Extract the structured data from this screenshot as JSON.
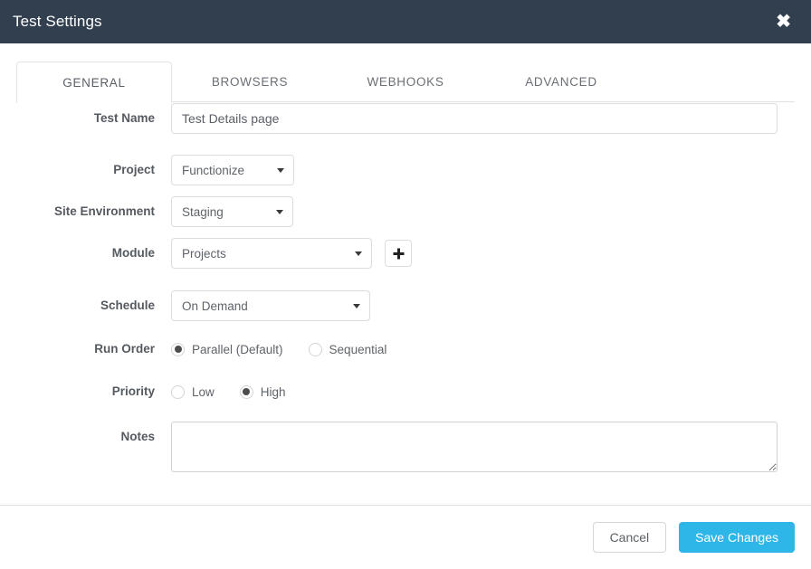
{
  "header": {
    "title": "Test Settings",
    "close_label": "✖"
  },
  "tabs": [
    {
      "label": "GENERAL",
      "active": true
    },
    {
      "label": "BROWSERS",
      "active": false
    },
    {
      "label": "WEBHOOKS",
      "active": false
    },
    {
      "label": "ADVANCED",
      "active": false
    }
  ],
  "form": {
    "test_name": {
      "label": "Test Name",
      "value": "Test Details page",
      "placeholder": "Test Name"
    },
    "project": {
      "label": "Project",
      "value": "Functionize"
    },
    "site_environment": {
      "label": "Site Environment",
      "value": "Staging"
    },
    "module": {
      "label": "Module",
      "value": "Projects",
      "add_label": "+"
    },
    "schedule": {
      "label": "Schedule",
      "value": "On Demand"
    },
    "run_order": {
      "label": "Run Order",
      "options": [
        {
          "label": "Parallel (Default)",
          "selected": true
        },
        {
          "label": "Sequential",
          "selected": false
        }
      ]
    },
    "priority": {
      "label": "Priority",
      "options": [
        {
          "label": "Low",
          "selected": false
        },
        {
          "label": "High",
          "selected": true
        }
      ]
    },
    "notes": {
      "label": "Notes",
      "value": "",
      "placeholder": ""
    }
  },
  "footer": {
    "cancel_label": "Cancel",
    "save_label": "Save Changes"
  },
  "colors": {
    "header_bg": "#323f4e",
    "accent": "#2fb6e8",
    "border": "#e2e2e2",
    "label_text": "#555a60"
  }
}
